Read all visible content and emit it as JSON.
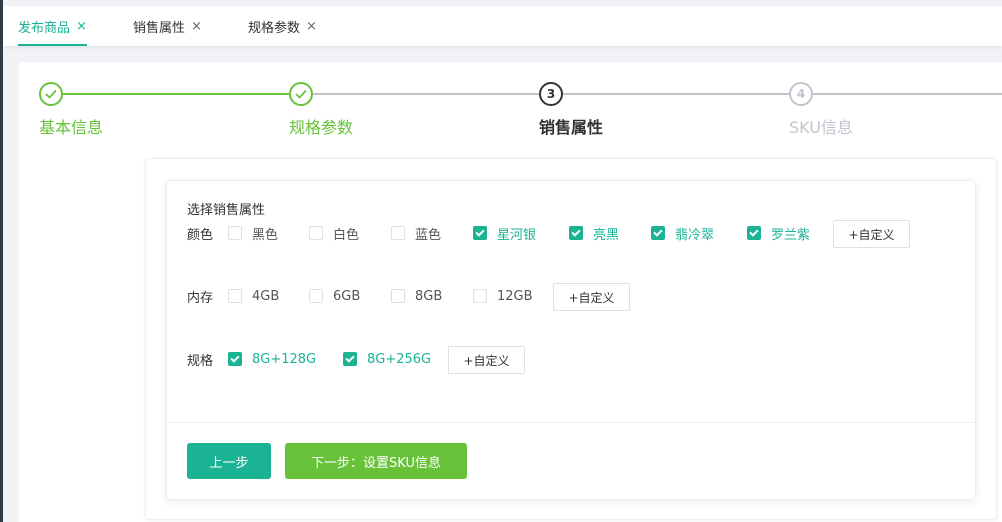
{
  "tabs": [
    {
      "label": "发布商品",
      "close": "×"
    },
    {
      "label": "销售属性",
      "close": "×"
    },
    {
      "label": "规格参数",
      "close": "×"
    }
  ],
  "steps": [
    {
      "number": "✓",
      "title": "基本信息",
      "status": "done"
    },
    {
      "number": "✓",
      "title": "规格参数",
      "status": "done"
    },
    {
      "number": "3",
      "title": "销售属性",
      "status": "current"
    },
    {
      "number": "4",
      "title": "SKU信息",
      "status": "todo"
    }
  ],
  "form": {
    "section_title": "选择销售属性",
    "color": {
      "label": "颜色",
      "options": [
        {
          "text": "黑色",
          "checked": false
        },
        {
          "text": "白色",
          "checked": false
        },
        {
          "text": "蓝色",
          "checked": false
        },
        {
          "text": "星河银",
          "checked": true
        },
        {
          "text": "亮黑",
          "checked": true
        },
        {
          "text": "翡冷翠",
          "checked": true
        },
        {
          "text": "罗兰紫",
          "checked": true
        }
      ],
      "custom_label": "+自定义"
    },
    "memory": {
      "label": "内存",
      "options": [
        {
          "text": "4GB",
          "checked": false
        },
        {
          "text": "6GB",
          "checked": false
        },
        {
          "text": "8GB",
          "checked": false
        },
        {
          "text": "12GB",
          "checked": false
        }
      ],
      "custom_label": "+自定义"
    },
    "spec": {
      "label": "规格",
      "options": [
        {
          "text": "8G+128G",
          "checked": true
        },
        {
          "text": "8G+256G",
          "checked": true
        }
      ],
      "custom_label": "+自定义"
    }
  },
  "actions": {
    "prev_label": "上一步",
    "next_label": "下一步：设置SKU信息"
  },
  "colors": {
    "primary": "#1ab394",
    "success": "#67c23a",
    "inactive": "#c0c4cc"
  }
}
